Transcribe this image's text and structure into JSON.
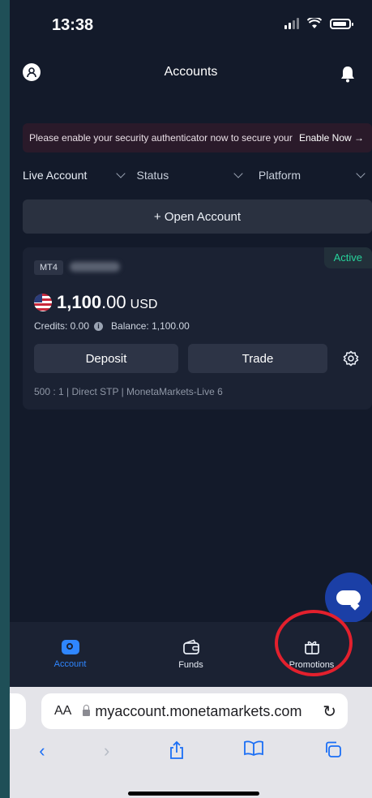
{
  "status_bar": {
    "time": "13:38"
  },
  "header": {
    "title": "Accounts",
    "avatar_icon": "user-avatar-icon",
    "bell_icon": "bell-icon"
  },
  "banner": {
    "text": "Please enable your security authenticator now to secure your account.",
    "link": "Enable Now →"
  },
  "filters": [
    {
      "label": "Live Account"
    },
    {
      "label": "Status"
    },
    {
      "label": "Platform"
    }
  ],
  "open_account": {
    "label": "+  Open Account"
  },
  "account": {
    "platform_badge": "MT4",
    "status": "Active",
    "balance_main": "1,100",
    "balance_decimals": ".00",
    "currency": "USD",
    "credits_label": "Credits: 0.00",
    "balance_label": "Balance:  1,100.00",
    "deposit_label": "Deposit",
    "trade_label": "Trade",
    "meta": "500 : 1  |  Direct STP  | MonetaMarkets-Live 6",
    "colors": {
      "active": "#27d39b"
    }
  },
  "bottom_nav": [
    {
      "label": "Account",
      "icon": "account-icon",
      "active": true
    },
    {
      "label": "Funds",
      "icon": "wallet-icon",
      "active": false
    },
    {
      "label": "Promotions",
      "icon": "gift-icon",
      "active": false
    }
  ],
  "browser": {
    "aa_label": "AA",
    "url": "myaccount.monetamarkets.com"
  }
}
